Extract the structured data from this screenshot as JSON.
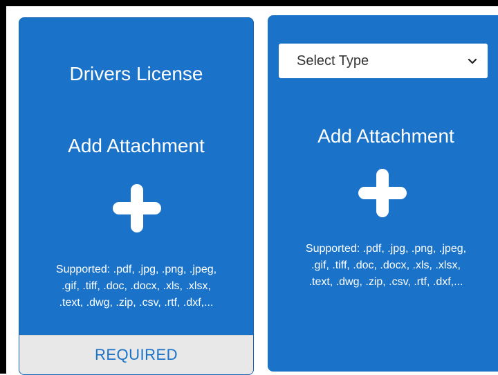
{
  "colors": {
    "card_blue": "#1a73c8",
    "required_bar_bg": "#e8e8e8",
    "required_text": "#1a73c8"
  },
  "cards": [
    {
      "title": "Drivers License",
      "add_label": "Add Attachment",
      "icon": "plus-icon",
      "supported_text": "Supported: .pdf, .jpg, .png, .jpeg,\n.gif, .tiff, .doc, .docx, .xls, .xlsx,\n.text, .dwg, .zip, .csv, .rtf, .dxf,...",
      "status": "REQUIRED"
    },
    {
      "type_select": {
        "selected": "Select Type",
        "icon": "chevron-down-icon"
      },
      "add_label": "Add Attachment",
      "icon": "plus-icon",
      "supported_text": "Supported: .pdf, .jpg, .png, .jpeg,\n.gif, .tiff, .doc, .docx, .xls, .xlsx,\n.text, .dwg, .zip, .csv, .rtf, .dxf,..."
    }
  ]
}
